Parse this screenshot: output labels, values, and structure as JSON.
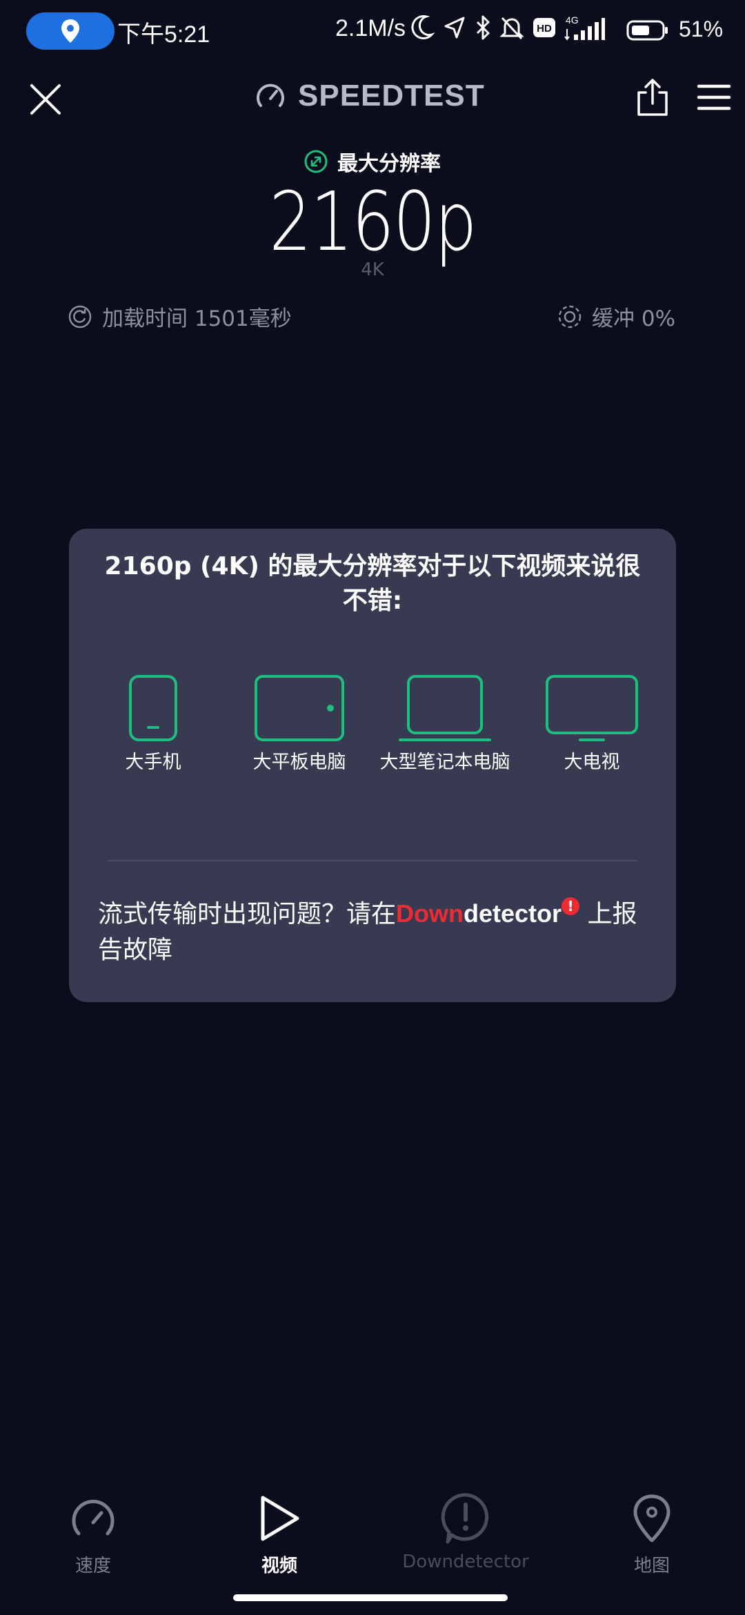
{
  "status_bar": {
    "time": "下午5:21",
    "net_speed": "2.1M/s",
    "hd": "HD",
    "network": "4G",
    "battery": "51%",
    "icons": [
      "location-icon",
      "moon-icon",
      "navigation-icon",
      "bluetooth-icon",
      "mute-icon",
      "hd-icon",
      "signal-icon",
      "battery-icon"
    ]
  },
  "header": {
    "brand": "SPEEDTEST",
    "icons": [
      "close-icon",
      "speedometer-icon",
      "share-icon",
      "menu-icon"
    ]
  },
  "result": {
    "label": "最大分辨率",
    "value": "2160p",
    "sub": "4K",
    "load_time": "加载时间 1501毫秒",
    "buffer": "缓冲 0%"
  },
  "card": {
    "title": "2160p (4K) 的最大分辨率对于以下视频来说很不错:",
    "devices": [
      {
        "label": "大手机",
        "icon": "phone-icon"
      },
      {
        "label": "大平板电脑",
        "icon": "tablet-icon"
      },
      {
        "label": "大型笔记本电脑",
        "icon": "laptop-icon"
      },
      {
        "label": "大电视",
        "icon": "tv-icon"
      }
    ],
    "report_prefix": "流式传输时出现问题？请在",
    "dd_down": "Down",
    "dd_detector": "detector",
    "dd_badge": "!",
    "report_suffix": "上报告故障"
  },
  "colors": {
    "background": "#0b0c1c",
    "card": "#383a52",
    "accent_green": "#1bbf7f",
    "downdetector_red": "#ee2a32",
    "location_pill": "#1e6fe0"
  },
  "nav": {
    "items": [
      {
        "label": "速度",
        "icon": "speedometer-icon",
        "active": false
      },
      {
        "label": "视频",
        "icon": "play-icon",
        "active": true
      },
      {
        "label": "Downdetector",
        "icon": "alert-icon",
        "active": false
      },
      {
        "label": "地图",
        "icon": "map-pin-icon",
        "active": false
      }
    ]
  }
}
